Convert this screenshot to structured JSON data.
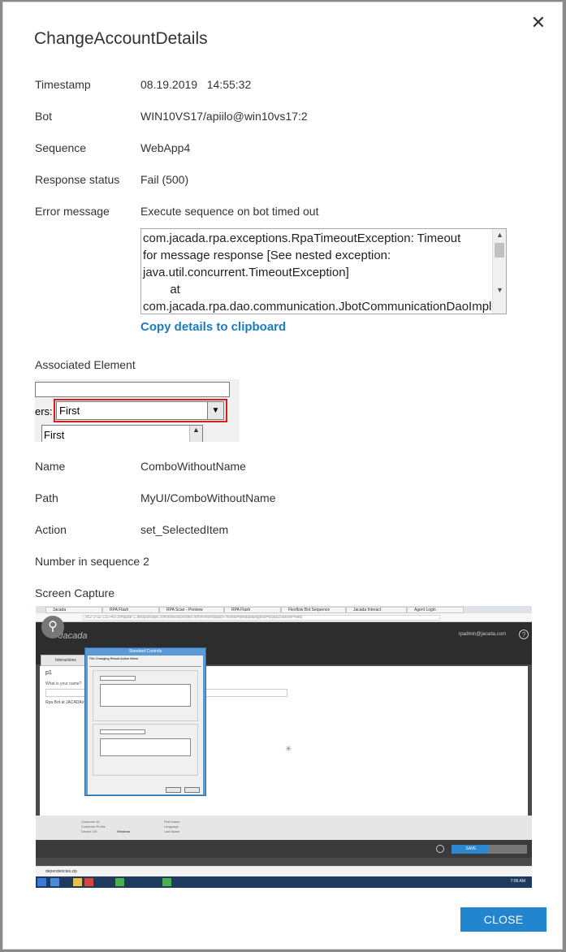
{
  "dialog": {
    "title": "ChangeAccountDetails",
    "close_icon": "close-icon",
    "close_button_label": "CLOSE"
  },
  "details": {
    "timestamp_label": "Timestamp",
    "timestamp_value": "08.19.2019   14:55:32",
    "bot_label": "Bot",
    "bot_value": "WIN10VS17/apiilo@win10vs17:2",
    "sequence_label": "Sequence",
    "sequence_value": "WebApp4",
    "response_status_label": "Response status",
    "response_status_value": "Fail (500)",
    "error_message_label": "Error message",
    "error_message_value": "Execute sequence on bot timed out",
    "error_details": "com.jacada.rpa.exceptions.RpaTimeoutException: Timeout\nfor message response [See nested exception:\njava.util.concurrent.TimeoutException]\n        at\ncom.jacada.rpa.dao.communication.JbotCommunicationDaoImpl",
    "copy_link": "Copy details to clipboard"
  },
  "associated_element": {
    "heading": "Associated Element",
    "snapshot_label": "ers:",
    "snapshot_combo_value": "First",
    "snapshot_list_item": "First",
    "name_label": "Name",
    "name_value": "ComboWithoutName",
    "path_label": "Path",
    "path_value": "MyUI/ComboWithoutName",
    "action_label": "Action",
    "action_value": "set_SelectedItem",
    "number_in_sequence": "Number in sequence 2"
  },
  "screen_capture": {
    "heading": "Screen Capture",
    "browser_tabs": [
      "Jacada",
      "RPA Flash",
      "RPA Scan - Preview",
      "RPA Flash",
      "Flexflow Bot Sequence",
      "Jacada Interact",
      "Agent Login"
    ],
    "url": "ec2-3-92-192-49.compute-1.amazonaws.com/interact/index.html#/workspace?flowId=default&loginId=true&channel=web",
    "logo": "Jacada",
    "user": "rpadmin@jacada.com",
    "interaction_tab": "Interactions",
    "page_heading": "p1",
    "question": "What is your name?",
    "rpa_text": "Rpa Bot at JACADA\\rpa",
    "window_title": "Standard Controls",
    "window_menu": "File   Changing   Result   Action Menu",
    "footer_left": [
      "Customer ID",
      "Customer Profile",
      "Device OS"
    ],
    "footer_os": "Windows",
    "footer_right": [
      "First Name",
      "Language",
      "Last Name"
    ],
    "save_label": "SAVE",
    "download_file": "dependencies.zip",
    "taskbar_time": "7:06 AM"
  },
  "colors": {
    "accent": "#2185cf",
    "link": "#1a7bc1",
    "highlight_border": "#d81d1d"
  }
}
